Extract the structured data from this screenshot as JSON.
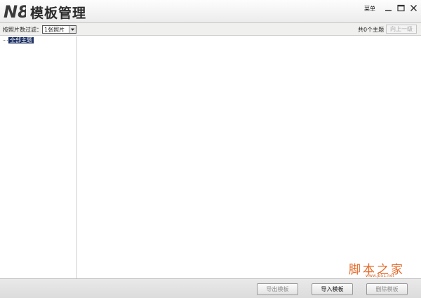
{
  "titlebar": {
    "logo_text": "N8",
    "title": "模板管理",
    "menu_label": "菜单"
  },
  "toolbar": {
    "filter_label": "按照片数过滤：",
    "filter_value": "1张照片",
    "count_text": "共0个主题",
    "up_button": "向上一级"
  },
  "tree": {
    "items": [
      {
        "label": "全部主题",
        "selected": true
      }
    ]
  },
  "bottom": {
    "export_label": "导出模板",
    "import_label": "导入模板",
    "delete_label": "删除模板"
  },
  "watermark": {
    "text": "脚本之家",
    "url": "www.jb51.net"
  },
  "colors": {
    "selection": "#1b2f63",
    "watermark": "#e46a2a"
  }
}
